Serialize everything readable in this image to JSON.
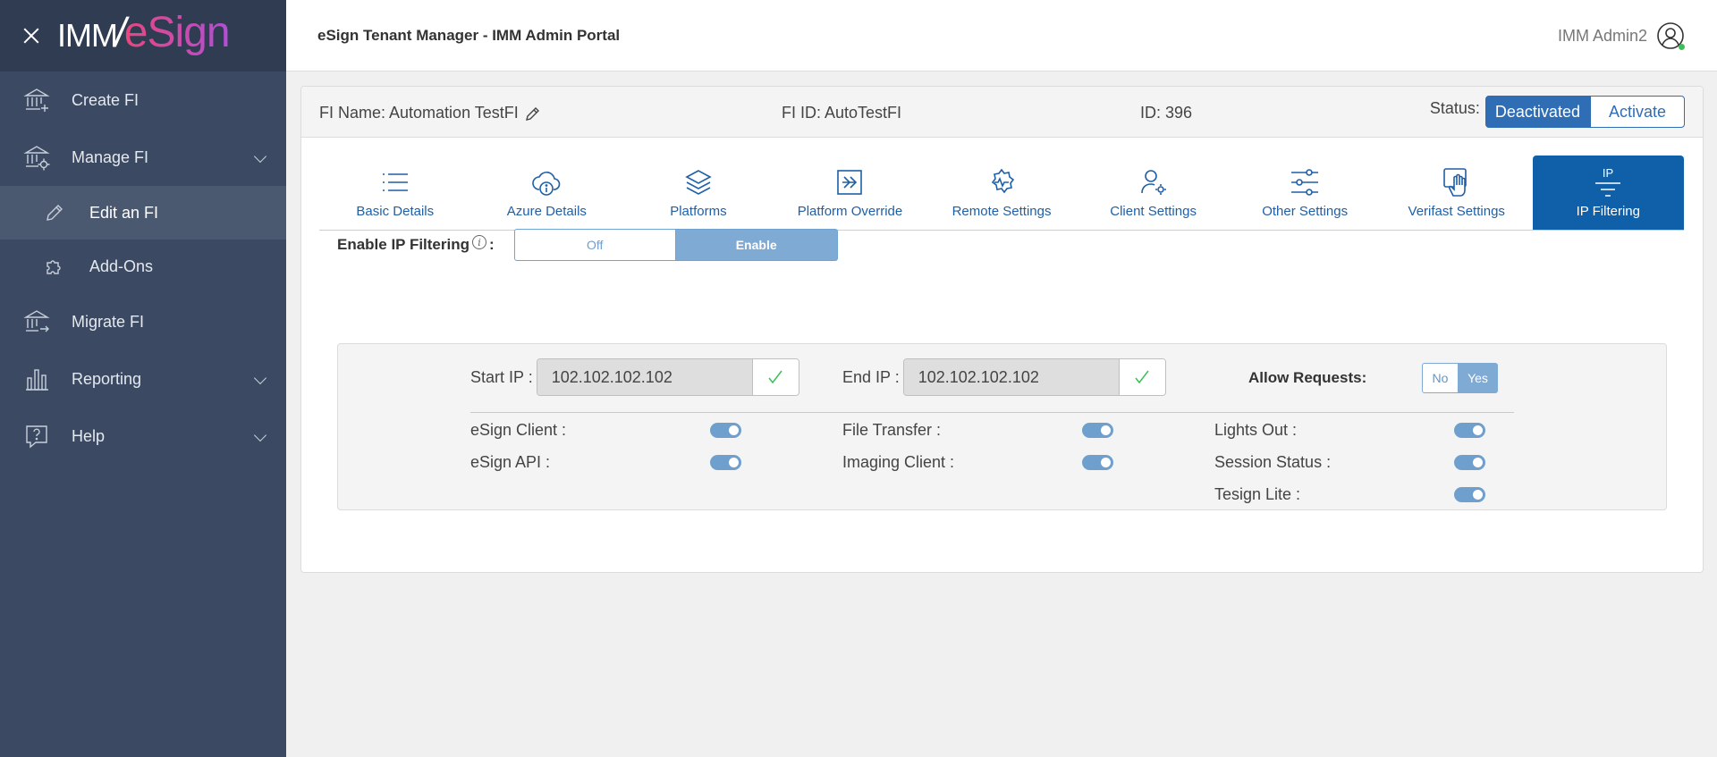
{
  "app": {
    "logo_left": "IMM",
    "logo_right": "eSign"
  },
  "sidebar": {
    "items": [
      {
        "label": "Create FI"
      },
      {
        "label": "Manage FI"
      },
      {
        "label": "Edit an FI"
      },
      {
        "label": "Add-Ons"
      },
      {
        "label": "Migrate FI"
      },
      {
        "label": "Reporting"
      },
      {
        "label": "Help"
      }
    ]
  },
  "header": {
    "title": "eSign Tenant Manager - IMM Admin Portal",
    "user": "IMM Admin2"
  },
  "fi": {
    "name": "FI Name: Automation TestFI",
    "fi_id": "FI ID: AutoTestFI",
    "id": "ID: 396",
    "status_label": "Status:",
    "deactivated": "Deactivated",
    "activate": "Activate"
  },
  "tabs": [
    {
      "label": "Basic Details",
      "icon": "list-icon"
    },
    {
      "label": "Azure Details",
      "icon": "cloud-info-icon"
    },
    {
      "label": "Platforms",
      "icon": "layers-icon"
    },
    {
      "label": "Platform Override",
      "icon": "arrow-box-icon"
    },
    {
      "label": "Remote Settings",
      "icon": "gear-signal-icon"
    },
    {
      "label": "Client Settings",
      "icon": "user-gear-icon"
    },
    {
      "label": "Other Settings",
      "icon": "sliders-icon"
    },
    {
      "label": "Verifast Settings",
      "icon": "hand-icon"
    },
    {
      "label": "IP Filtering",
      "icon": "ip-filter-icon",
      "icon_text": "IP",
      "active": true
    }
  ],
  "ip_filtering": {
    "label": "Enable IP Filtering",
    "colon": ":",
    "info_glyph": "i",
    "off": "Off",
    "enable": "Enable",
    "selected": "Enable"
  },
  "rule": {
    "start_label": "Start IP :",
    "start_value": "102.102.102.102",
    "end_label": "End IP :",
    "end_value": "102.102.102.102",
    "allow_label": "Allow Requests:",
    "no": "No",
    "yes": "Yes",
    "selected": "Yes",
    "toggles": [
      {
        "label": "eSign Client :",
        "on": true
      },
      {
        "label": "eSign API :",
        "on": true
      },
      {
        "label": "File Transfer :",
        "on": true
      },
      {
        "label": "Imaging Client :",
        "on": true
      },
      {
        "label": "Lights Out :",
        "on": true
      },
      {
        "label": "Session Status :",
        "on": true
      },
      {
        "label": "Tesign Lite :",
        "on": true
      }
    ]
  },
  "colors": {
    "sidebar": "#3b4a62",
    "primary": "#2f6db5",
    "active_tab": "#0f5fa9",
    "toggle_on": "#6f9fcc"
  }
}
